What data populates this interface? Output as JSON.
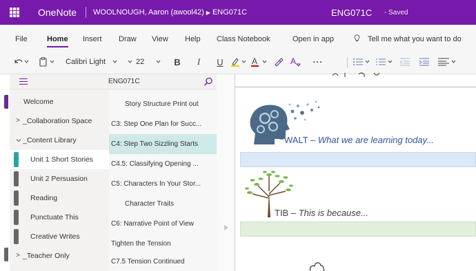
{
  "titlebar": {
    "app_name": "OneNote",
    "breadcrumb_owner": "WOOLNOUGH, Aaron (awool42)",
    "breadcrumb_notebook": "ENG071C",
    "doc_title": "ENG071C",
    "save_status": "-  Saved",
    "accent_color": "#7719aa"
  },
  "ribbon_tabs": {
    "file": "File",
    "home": "Home",
    "insert": "Insert",
    "draw": "Draw",
    "view": "View",
    "help": "Help",
    "class_notebook": "Class Notebook",
    "open_in_app": "Open in app",
    "tell_me": "Tell me what you want to do"
  },
  "toolbar": {
    "font_name": "Calibri Light",
    "font_size": "22",
    "bold": "B",
    "italic": "I",
    "underline": "U",
    "font_color_glyph": "A",
    "more": "···",
    "icons": [
      "undo-icon",
      "clipboard-icon",
      "highlighter-icon",
      "font-color-icon",
      "format-painter-icon",
      "clear-formatting-icon",
      "bullet-list-icon",
      "numbered-list-icon",
      "decrease-indent-icon",
      "increase-indent-icon",
      "align-icon"
    ]
  },
  "navigation": {
    "notebook_title": "ENG071C",
    "sections": [
      {
        "label": "Welcome",
        "color": "#6b2c91"
      },
      {
        "label": "_Collaboration Space",
        "color": "#555555",
        "group": true,
        "expanded": false
      },
      {
        "label": "_Content Library",
        "color": "#555555",
        "group": true,
        "expanded": true
      },
      {
        "label": "Unit 1 Short Stories",
        "color": "#29a3a3",
        "selected": true
      },
      {
        "label": "Unit 2 Persuasion",
        "color": "#666666"
      },
      {
        "label": "Reading",
        "color": "#666666"
      },
      {
        "label": "Punctuate This",
        "color": "#666666"
      },
      {
        "label": "Creative Writes",
        "color": "#666666"
      },
      {
        "label": "_Teacher Only",
        "color": "#555555",
        "group": true,
        "expanded": false
      }
    ],
    "pages": [
      {
        "label": "Story Structure Print out",
        "indent": true
      },
      {
        "label": "C3: Step One Plan for Succ..."
      },
      {
        "label": "C4: Step Two Sizzling Starts",
        "selected": true
      },
      {
        "label": "C4.5: Classifying Opening ..."
      },
      {
        "label": "C5: Characters In Your Stor..."
      },
      {
        "label": "Character Traits",
        "indent": true
      },
      {
        "label": "C6: Narrative Point of View"
      },
      {
        "label": "Tighten the Tension"
      },
      {
        "label": "C7.5 Tension Continued"
      }
    ]
  },
  "canvas": {
    "walt_prefix": "WALT – ",
    "walt_italic": "What we are learning today...",
    "tib_prefix": "TIB – ",
    "tib_italic": "This is because...",
    "walt_bar_color": "#dbe8f5",
    "tib_bar_color": "#e2efda"
  }
}
